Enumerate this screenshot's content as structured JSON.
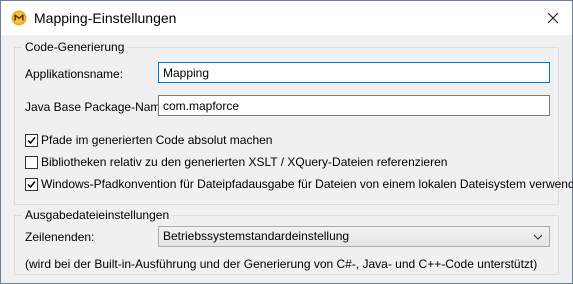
{
  "window": {
    "title": "Mapping-Einstellungen"
  },
  "code_generation": {
    "legend": "Code-Generierung",
    "app_name_label": "Applikationsname:",
    "app_name_value": "Mapping",
    "java_package_label": "Java Base Package-Name:",
    "java_package_value": "com.mapforce",
    "checkboxes": [
      {
        "label": "Pfade im generierten Code absolut machen",
        "checked": true
      },
      {
        "label": "Bibliotheken relativ zu den generierten XSLT / XQuery-Dateien referenzieren",
        "checked": false
      },
      {
        "label": "Windows-Pfadkonvention für Dateipfadausgabe für Dateien von einem lokalen Dateisystem verwenden",
        "checked": true
      }
    ]
  },
  "output_settings": {
    "legend": "Ausgabedateieinstellungen",
    "line_endings_label": "Zeilenenden:",
    "line_endings_value": "Betriebssystemstandardeinstellung",
    "note": "(wird bei der Built-in-Ausführung und der Generierung von C#-, Java- und C++-Code unterstützt)"
  },
  "icons": {
    "app": "mapforce-app-icon",
    "close": "close-icon",
    "check": "checkmark-icon",
    "dropdown": "chevron-down-icon"
  },
  "colors": {
    "app_icon_orange": "#f0a81e",
    "focus_border": "#0078d7"
  }
}
